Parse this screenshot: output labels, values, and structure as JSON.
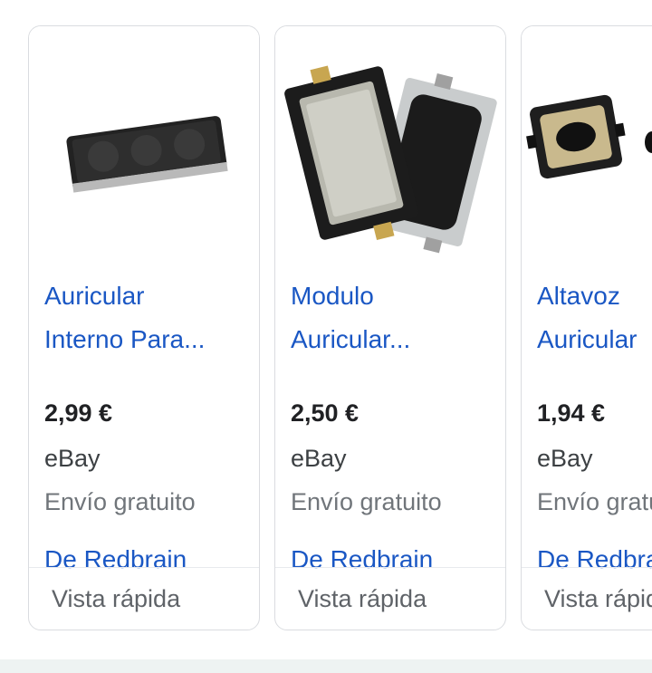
{
  "products": [
    {
      "title_line1": "Auricular",
      "title_line2": "Interno Para...",
      "price": "2,99 €",
      "store": "eBay",
      "shipping": "Envío gratuito",
      "seller": "De Redbrain",
      "quick_view": "Vista rápida"
    },
    {
      "title_line1": "Modulo",
      "title_line2": "Auricular...",
      "price": "2,50 €",
      "store": "eBay",
      "shipping": "Envío gratuito",
      "seller": "De Redbrain",
      "quick_view": "Vista rápida"
    },
    {
      "title_line1": "Altavoz",
      "title_line2": "Auricular",
      "price": "1,94 €",
      "store": "eBay",
      "shipping": "Envío gratuito",
      "seller": "De Redbrain",
      "quick_view": "Vista rápida"
    }
  ],
  "colors": {
    "link_blue": "#1a57c4",
    "card_border": "#dadce0",
    "footer_bg": "#eef3f2"
  }
}
